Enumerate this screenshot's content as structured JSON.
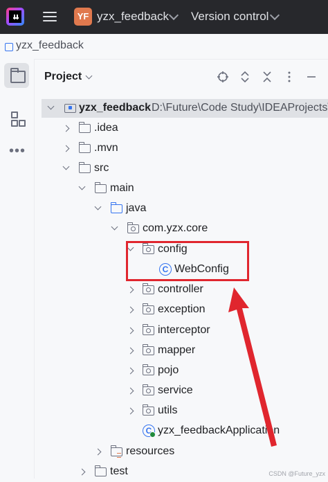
{
  "titlebar": {
    "project_badge": "YF",
    "project_name": "yzx_feedback",
    "vcs_label": "Version control",
    "icons": [
      "app-logo-icon",
      "hamburger-menu-icon",
      "chevron-down-icon"
    ]
  },
  "breadcrumb": {
    "text": "yzx_feedback"
  },
  "toolstrip": {
    "items": [
      "project-folder-icon",
      "structure-icon",
      "more-dots-icon"
    ],
    "more": "•••"
  },
  "panel": {
    "title": "Project",
    "tools": [
      "locate-icon",
      "expand-all-icon",
      "collapse-all-icon",
      "options-icon",
      "hide-icon"
    ]
  },
  "tree": {
    "root_name": "yzx_feedback",
    "root_path": "D:\\Future\\Code Study\\IDEAProjects\\",
    "items": {
      "idea": ".idea",
      "mvn": ".mvn",
      "src": "src",
      "main": "main",
      "java": "java",
      "pkg": "com.yzx.core",
      "config": "config",
      "webconfig": "WebConfig",
      "controller": "controller",
      "exception": "exception",
      "interceptor": "interceptor",
      "mapper": "mapper",
      "pojo": "pojo",
      "service": "service",
      "utils": "utils",
      "app": "yzx_feedbackApplication",
      "resources": "resources",
      "test": "test"
    },
    "class_glyph": "C"
  },
  "annotation": {
    "color": "#e0262e"
  },
  "watermark": "CSDN @Future_yzx"
}
